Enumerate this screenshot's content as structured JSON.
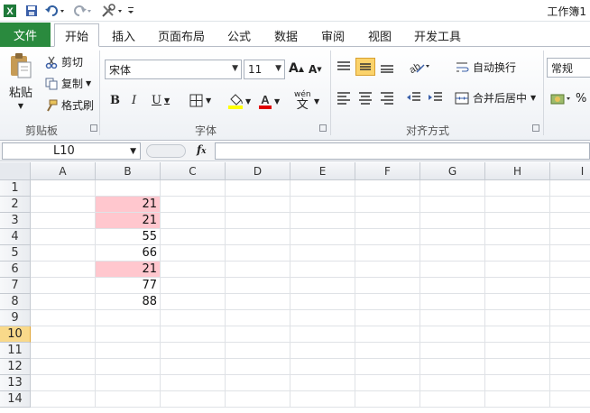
{
  "window": {
    "title": "工作簿1"
  },
  "tabs": [
    "文件",
    "开始",
    "插入",
    "页面布局",
    "公式",
    "数据",
    "审阅",
    "视图",
    "开发工具"
  ],
  "clipboard": {
    "paste": "粘贴",
    "cut": "剪切",
    "copy": "复制",
    "format_painter": "格式刷",
    "group": "剪贴板"
  },
  "font": {
    "name": "宋体",
    "size": "11",
    "group": "字体",
    "bold": "B",
    "italic": "I",
    "underline": "U",
    "phonetic_top": "wén",
    "phonetic_bottom": "文"
  },
  "alignment": {
    "wrap": "自动换行",
    "merge": "合并后居中",
    "group": "对齐方式"
  },
  "number": {
    "format": "常规"
  },
  "formula_bar": {
    "name_box": "L10",
    "fx": "fx",
    "value": ""
  },
  "columns": [
    "A",
    "B",
    "C",
    "D",
    "E",
    "F",
    "G",
    "H",
    "I"
  ],
  "rows": [
    "1",
    "2",
    "3",
    "4",
    "5",
    "6",
    "7",
    "8",
    "9",
    "10",
    "11",
    "12",
    "13",
    "14"
  ],
  "selected_row": "10",
  "cells_B": [
    "",
    "21",
    "21",
    "55",
    "66",
    "21",
    "77",
    "88",
    "",
    "",
    "",
    "",
    "",
    ""
  ],
  "highlighted_rows": [
    "2",
    "3",
    "6"
  ],
  "colors": {
    "highlight": "#ffc7ce",
    "file_tab": "#2a8a3e",
    "selected_header": "#f9d98a"
  }
}
